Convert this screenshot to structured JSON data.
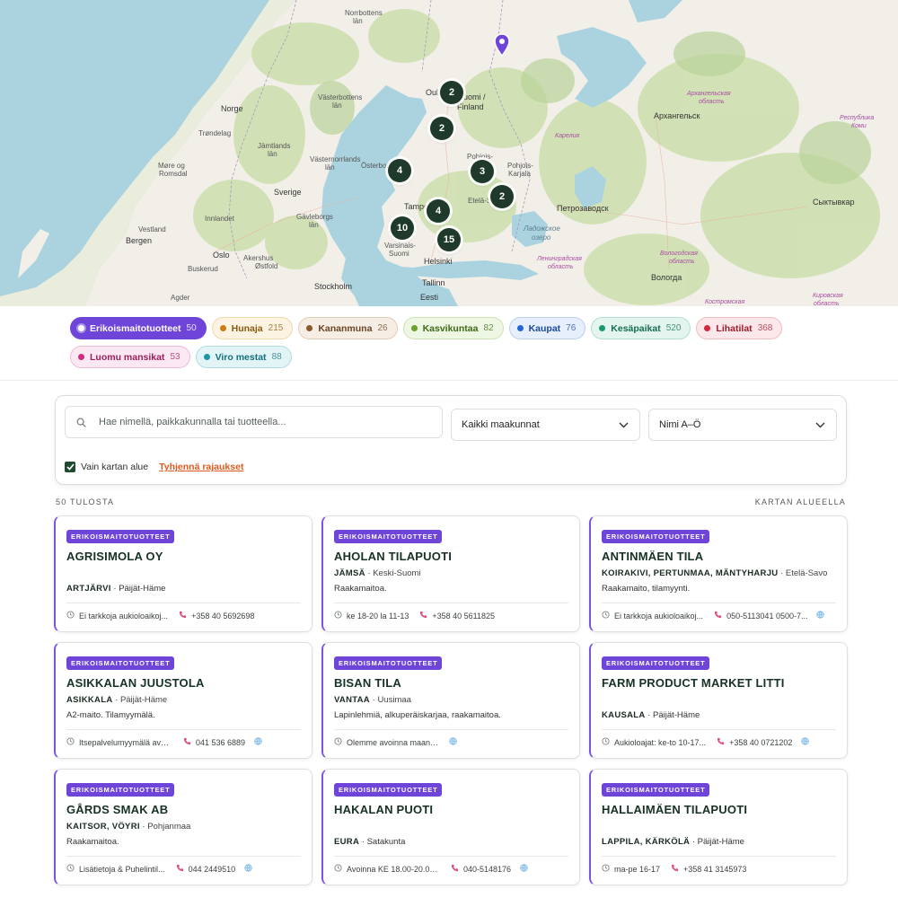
{
  "map": {
    "labels": [
      {
        "text": "Norrbottens",
        "cls": "",
        "l": 384,
        "t": 10
      },
      {
        "text": "län",
        "cls": "",
        "l": 393,
        "t": 19
      },
      {
        "text": "Norge",
        "cls": "big",
        "l": 246,
        "t": 117
      },
      {
        "text": "Västerbottens",
        "cls": "",
        "l": 354,
        "t": 104
      },
      {
        "text": "län",
        "cls": "",
        "l": 370,
        "t": 113
      },
      {
        "text": "Trøndelag",
        "cls": "",
        "l": 221,
        "t": 144
      },
      {
        "text": "Jämtlands",
        "cls": "",
        "l": 287,
        "t": 158
      },
      {
        "text": "län",
        "cls": "",
        "l": 298,
        "t": 167
      },
      {
        "text": "Møre og",
        "cls": "",
        "l": 176,
        "t": 180
      },
      {
        "text": "Romsdal",
        "cls": "",
        "l": 177,
        "t": 189
      },
      {
        "text": "Västernorrlands",
        "cls": "",
        "l": 345,
        "t": 173
      },
      {
        "text": "län",
        "cls": "",
        "l": 362,
        "t": 182
      },
      {
        "text": "Sverige",
        "cls": "big",
        "l": 305,
        "t": 210
      },
      {
        "text": "Innlandet",
        "cls": "",
        "l": 228,
        "t": 239
      },
      {
        "text": "Vestland",
        "cls": "",
        "l": 154,
        "t": 251
      },
      {
        "text": "Bergen",
        "cls": "big",
        "l": 140,
        "t": 264
      },
      {
        "text": "Gävleborgs",
        "cls": "",
        "l": 330,
        "t": 237
      },
      {
        "text": "län",
        "cls": "",
        "l": 344,
        "t": 246
      },
      {
        "text": "Oslo",
        "cls": "big",
        "l": 237,
        "t": 280
      },
      {
        "text": "Buskerud",
        "cls": "",
        "l": 209,
        "t": 295
      },
      {
        "text": "Akershus",
        "cls": "",
        "l": 271,
        "t": 283
      },
      {
        "text": "Østfold",
        "cls": "",
        "l": 284,
        "t": 292
      },
      {
        "text": "Stockholm",
        "cls": "big",
        "l": 350,
        "t": 315
      },
      {
        "text": "Agder",
        "cls": "",
        "l": 190,
        "t": 327
      },
      {
        "text": "Oulu",
        "cls": "big",
        "l": 474,
        "t": 99
      },
      {
        "text": "Suomi /",
        "cls": "big",
        "l": 510,
        "t": 104
      },
      {
        "text": "Finland",
        "cls": "big",
        "l": 509,
        "t": 115
      },
      {
        "text": "Pohjois-",
        "cls": "",
        "l": 520,
        "t": 170
      },
      {
        "text": "Pohjois-",
        "cls": "",
        "l": 565,
        "t": 180
      },
      {
        "text": "Karjala",
        "cls": "",
        "l": 566,
        "t": 189
      },
      {
        "text": "Österbotten",
        "cls": "",
        "l": 402,
        "t": 180
      },
      {
        "text": "Tampe",
        "cls": "big",
        "l": 450,
        "t": 226
      },
      {
        "text": "Etelä-Sa",
        "cls": "",
        "l": 521,
        "t": 219
      },
      {
        "text": "Varsinais-",
        "cls": "",
        "l": 428,
        "t": 269
      },
      {
        "text": "Suomi",
        "cls": "",
        "l": 433,
        "t": 278
      },
      {
        "text": "Helsinki",
        "cls": "big",
        "l": 472,
        "t": 287
      },
      {
        "text": "Tallinn",
        "cls": "big",
        "l": 470,
        "t": 311
      },
      {
        "text": "Eesti",
        "cls": "big",
        "l": 468,
        "t": 327
      },
      {
        "text": "Карелия",
        "cls": "ru",
        "l": 618,
        "t": 147
      },
      {
        "text": "Архангельск",
        "cls": "big",
        "l": 728,
        "t": 125
      },
      {
        "text": "Архангельская",
        "cls": "ru",
        "l": 765,
        "t": 100
      },
      {
        "text": "область",
        "cls": "ru",
        "l": 778,
        "t": 109
      },
      {
        "text": "Республика",
        "cls": "ru",
        "l": 935,
        "t": 127
      },
      {
        "text": "Коми",
        "cls": "ru",
        "l": 948,
        "t": 136
      },
      {
        "text": "Петрозаводск",
        "cls": "big",
        "l": 620,
        "t": 228
      },
      {
        "text": "Сыктывкар",
        "cls": "big",
        "l": 905,
        "t": 221
      },
      {
        "text": "Ладожское",
        "cls": "water",
        "l": 583,
        "t": 250
      },
      {
        "text": "озеро",
        "cls": "water",
        "l": 592,
        "t": 260
      },
      {
        "text": "Ленинградская",
        "cls": "ru",
        "l": 598,
        "t": 284
      },
      {
        "text": "область",
        "cls": "ru",
        "l": 610,
        "t": 293
      },
      {
        "text": "Вологодская",
        "cls": "ru",
        "l": 735,
        "t": 278
      },
      {
        "text": "область",
        "cls": "ru",
        "l": 745,
        "t": 287
      },
      {
        "text": "Вологда",
        "cls": "big",
        "l": 725,
        "t": 305
      },
      {
        "text": "Кировская",
        "cls": "ru",
        "l": 905,
        "t": 325
      },
      {
        "text": "область",
        "cls": "ru",
        "l": 906,
        "t": 334
      },
      {
        "text": "Костромская",
        "cls": "ru",
        "l": 785,
        "t": 332
      }
    ],
    "clusters": [
      {
        "n": "2",
        "l": 490,
        "t": 90
      },
      {
        "n": "2",
        "l": 479,
        "t": 130
      },
      {
        "n": "4",
        "l": 432,
        "t": 177
      },
      {
        "n": "3",
        "l": 524,
        "t": 178
      },
      {
        "n": "2",
        "l": 546,
        "t": 206
      },
      {
        "n": "4",
        "l": 475,
        "t": 222
      },
      {
        "n": "10",
        "l": 435,
        "t": 241
      },
      {
        "n": "15",
        "l": 487,
        "t": 254
      }
    ]
  },
  "chips": [
    {
      "label": "Erikoismaitotuotteet",
      "count": "50",
      "active": true,
      "color": "#6f45d9",
      "bg": "#6f45d9",
      "border": "#6f45d9",
      "text": "#ffffff"
    },
    {
      "label": "Hunaja",
      "count": "215",
      "active": false,
      "color": "#c97d12",
      "bg": "#fdf3e2",
      "border": "#f1d9aa",
      "text": "#8a5a10"
    },
    {
      "label": "Kananmuna",
      "count": "26",
      "active": false,
      "color": "#8a5a2e",
      "bg": "#f6ede4",
      "border": "#e3cdb8",
      "text": "#6b4424"
    },
    {
      "label": "Kasvikuntaa",
      "count": "82",
      "active": false,
      "color": "#6aa12a",
      "bg": "#eef6e4",
      "border": "#cfe3b5",
      "text": "#3e6a14"
    },
    {
      "label": "Kaupat",
      "count": "76",
      "active": false,
      "color": "#2166d6",
      "bg": "#e7effc",
      "border": "#bcd0f2",
      "text": "#1a4aa0"
    },
    {
      "label": "Kesäpaikat",
      "count": "520",
      "active": false,
      "color": "#1a9a72",
      "bg": "#e4f5ef",
      "border": "#b4e0cf",
      "text": "#136e52"
    },
    {
      "label": "Lihatilat",
      "count": "368",
      "active": false,
      "color": "#d1283f",
      "bg": "#fce8ea",
      "border": "#f2bcc4",
      "text": "#9e1d2f"
    },
    {
      "label": "Luomu mansikat",
      "count": "53",
      "active": false,
      "color": "#d42a7e",
      "bg": "#fce8f2",
      "border": "#f0bcd7",
      "text": "#9e1e5e"
    },
    {
      "label": "Viro mestat",
      "count": "88",
      "active": false,
      "color": "#1a96a6",
      "bg": "#e2f4f6",
      "border": "#b2dde3",
      "text": "#14707d"
    }
  ],
  "search": {
    "placeholder": "Hae nimellä, paikkakunnalla tai tuotteella...",
    "region_select": "Kaikki maakunnat",
    "sort_select": "Nimi A–Ö",
    "map_area_only_label": "Vain kartan alue",
    "clear_filters_label": "Tyhjennä rajaukset"
  },
  "results": {
    "count_label": "50 TULOSTA",
    "area_label": "KARTAN ALUEELLA"
  },
  "cards": [
    {
      "badge": "ERIKOISMAITOTUOTTEET",
      "title": "AGRISIMOLA OY",
      "place": "",
      "region": "",
      "desc": "",
      "place2": "ARTJÄRVI",
      "region2": "Päijät-Häme",
      "hours": "Ei tarkkoja aukioloaikoj...",
      "phone": "+358 40 5692698",
      "web": false
    },
    {
      "badge": "ERIKOISMAITOTUOTTEET",
      "title": "AHOLAN TILAPUOTI",
      "place": "JÄMSÄ",
      "region": "Keski-Suomi",
      "desc": "Raakamaitoa.",
      "place2": "",
      "region2": "",
      "hours": "ke 18-20 la 11-13",
      "phone": "+358 40 5611825",
      "web": false
    },
    {
      "badge": "ERIKOISMAITOTUOTTEET",
      "title": "ANTINMÄEN TILA",
      "place": "KOIRAKIVI, PERTUNMAA, MÄNTYHARJU",
      "region": "Etelä-Savo",
      "desc": "Raakamaito, tilamyynti.",
      "place2": "",
      "region2": "",
      "hours": "Ei tarkkoja aukioloaikoj...",
      "phone": "050-5113041 0500-7...",
      "web": true
    },
    {
      "badge": "ERIKOISMAITOTUOTTEET",
      "title": "ASIKKALAN JUUSTOLA",
      "place": "ASIKKALA",
      "region": "Päijät-Häme",
      "desc": "A2-maito. Tilamyymälä.",
      "place2": "",
      "region2": "",
      "hours": "Itsepalvelumyymälä avoin...",
      "phone": "041 536 6889",
      "web": true
    },
    {
      "badge": "ERIKOISMAITOTUOTTEET",
      "title": "BISAN TILA",
      "place": "VANTAA",
      "region": "Uusimaa",
      "desc": "Lapinlehmiä, alkuperäiskarjaa, raakamaitoa.",
      "place2": "",
      "region2": "",
      "hours": "Olemme avoinna maanantai...",
      "phone": "",
      "web": true
    },
    {
      "badge": "ERIKOISMAITOTUOTTEET",
      "title": "FARM PRODUCT MARKET LITTI",
      "place": "",
      "region": "",
      "desc": "",
      "place2": "KAUSALA",
      "region2": "Päijät-Häme",
      "hours": "Aukioloajat: ke-to 10-17...",
      "phone": "+358 40 0721202",
      "web": true
    },
    {
      "badge": "ERIKOISMAITOTUOTTEET",
      "title": "GÅRDS SMAK AB",
      "place": "KAITSOR, VÖYRI",
      "region": "Pohjanmaa",
      "desc": "Raakamaitoa.",
      "place2": "",
      "region2": "",
      "hours": "Lisätietoja & Puhelintil...",
      "phone": "044 2449510",
      "web": true
    },
    {
      "badge": "ERIKOISMAITOTUOTTEET",
      "title": "HAKALAN PUOTI",
      "place": "",
      "region": "",
      "desc": "",
      "place2": "EURA",
      "region2": "Satakunta",
      "hours": "Avoinna KE 18.00-20.00 j...",
      "phone": "040-5148176",
      "web": true
    },
    {
      "badge": "ERIKOISMAITOTUOTTEET",
      "title": "HALLAIMÄEN TILAPUOTI",
      "place": "",
      "region": "",
      "desc": "",
      "place2": "LAPPILA, KÄRKÖLÄ",
      "region2": "Päijät-Häme",
      "hours": "ma-pe 16-17",
      "phone": "+358 41 3145973",
      "web": false
    }
  ]
}
